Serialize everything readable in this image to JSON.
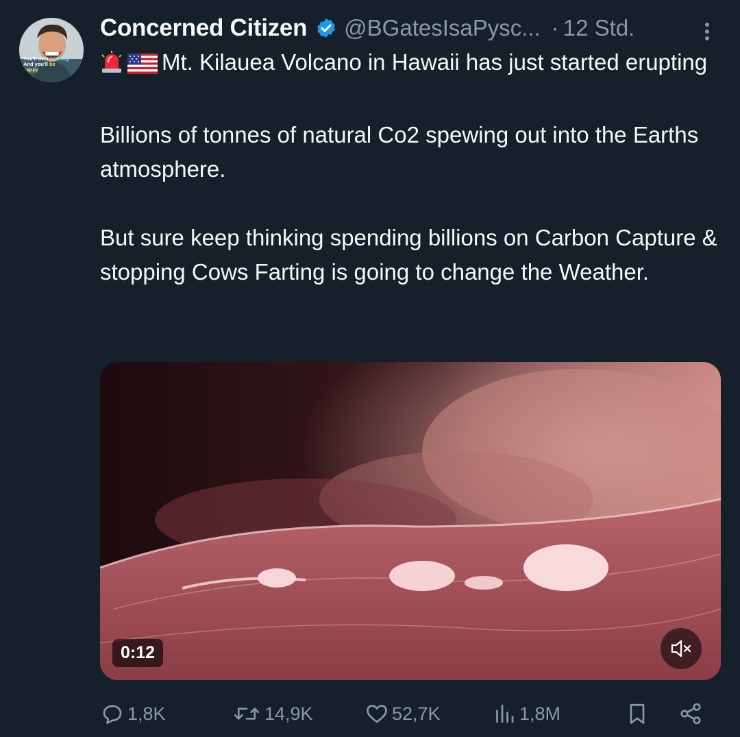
{
  "author": {
    "display_name": "Concerned Citizen",
    "handle": "@BGatesIsaPysc...",
    "separator": "·",
    "time": "12 Std.",
    "verified": true,
    "avatar_caption_line1_a": "You'll own ",
    "avatar_caption_line1_b": "nothing",
    "avatar_caption_line2_a": "And you'll ",
    "avatar_caption_line2_b": "be happy"
  },
  "tweet": {
    "lead_emojis": [
      "rotating-light-emoji",
      "us-flag-emoji"
    ],
    "paragraph1": "Mt. Kilauea Volcano in Hawaii has just started erupting",
    "paragraph2": "Billions of tonnes of natural Co2 spewing out into the Earths atmosphere.",
    "paragraph3": "But sure keep thinking spending billions on Carbon Capture & stopping Cows Farting is going to change the Weather."
  },
  "media": {
    "video_time": "0:12",
    "muted": true
  },
  "actions": {
    "replies": "1,8K",
    "reposts": "14,9K",
    "likes": "52,7K",
    "views": "1,8M"
  },
  "colors": {
    "background": "#15202b",
    "text": "#f7f9f9",
    "secondary": "#8b98a5",
    "verified": "#1d9bf0"
  }
}
